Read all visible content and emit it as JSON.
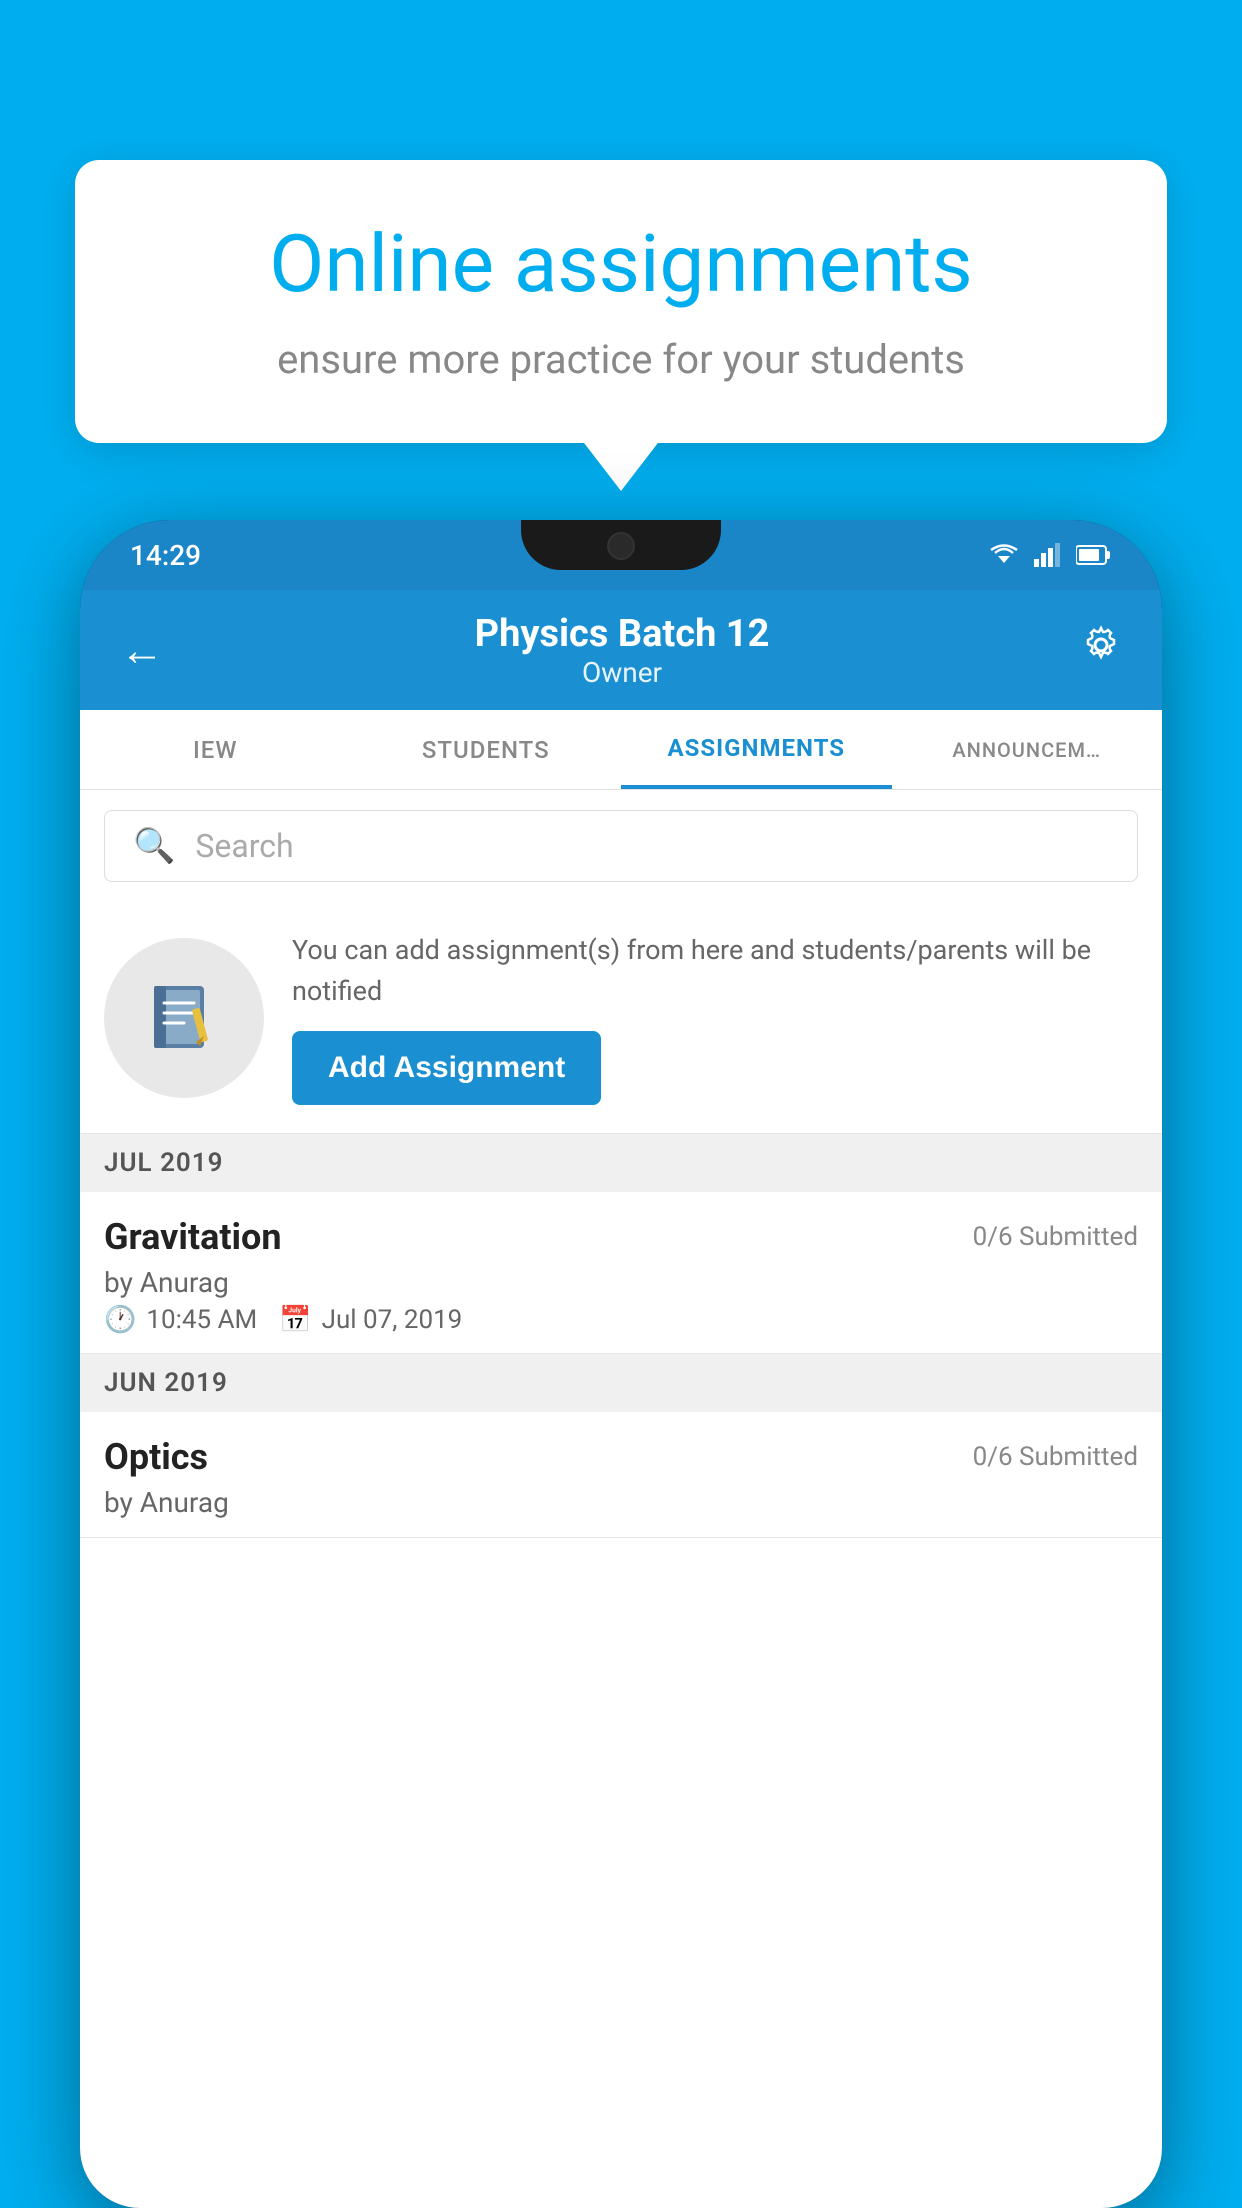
{
  "background_color": "#00AEEF",
  "tooltip": {
    "title": "Online assignments",
    "subtitle": "ensure more practice for your students"
  },
  "status_bar": {
    "time": "14:29"
  },
  "header": {
    "title": "Physics Batch 12",
    "subtitle": "Owner",
    "back_label": "←",
    "settings_label": "⚙"
  },
  "tabs": [
    {
      "label": "IEW",
      "active": false
    },
    {
      "label": "STUDENTS",
      "active": false
    },
    {
      "label": "ASSIGNMENTS",
      "active": true
    },
    {
      "label": "ANNOUNCEM…",
      "active": false
    }
  ],
  "search": {
    "placeholder": "Search"
  },
  "info_card": {
    "description": "You can add assignment(s) from here and students/parents will be notified",
    "button_label": "Add Assignment"
  },
  "sections": [
    {
      "label": "JUL 2019",
      "assignments": [
        {
          "name": "Gravitation",
          "submitted": "0/6 Submitted",
          "by": "by Anurag",
          "time": "10:45 AM",
          "date": "Jul 07, 2019"
        }
      ]
    },
    {
      "label": "JUN 2019",
      "assignments": [
        {
          "name": "Optics",
          "submitted": "0/6 Submitted",
          "by": "by Anurag",
          "time": "",
          "date": ""
        }
      ]
    }
  ]
}
